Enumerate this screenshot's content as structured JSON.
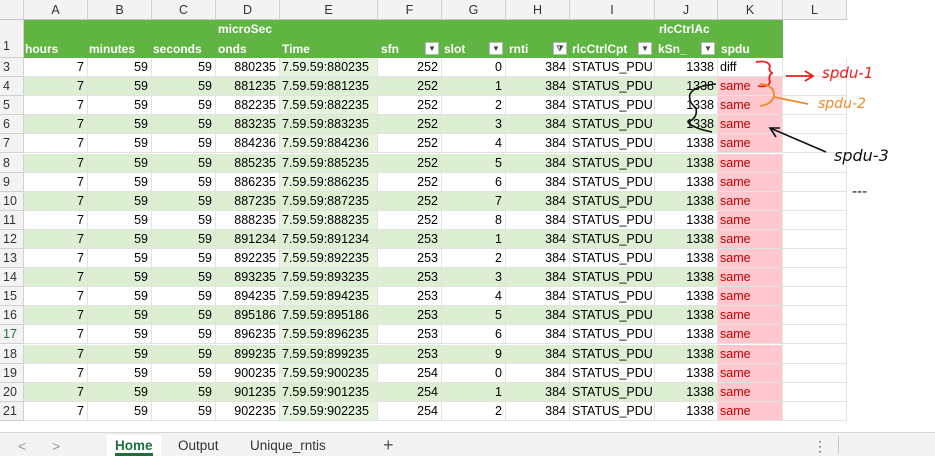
{
  "columns": [
    "A",
    "B",
    "C",
    "D",
    "E",
    "F",
    "G",
    "H",
    "I",
    "J",
    "K",
    "L"
  ],
  "header": {
    "row_number": "1",
    "hours": "hours",
    "minutes": "minutes",
    "seconds": "seconds",
    "microsec_1": "microSec",
    "microsec_2": "onds",
    "time": "Time",
    "sfn": "sfn",
    "slot": "slot",
    "rnti": "rnti",
    "rlcCtrlCpt": "rlcCtrlCpt",
    "rlcCtrlAck_1": "rlcCtrlAc",
    "rlcCtrlAck_2": "kSn_",
    "spdu": "spdu"
  },
  "rows": [
    {
      "n": "3",
      "hours": "7",
      "minutes": "59",
      "seconds": "59",
      "micro": "880235",
      "time": "7.59.59:880235",
      "sfn": "252",
      "slot": "0",
      "rnti": "384",
      "cpt": "STATUS_PDU",
      "ack": "1338",
      "spdu": "diff"
    },
    {
      "n": "4",
      "hours": "7",
      "minutes": "59",
      "seconds": "59",
      "micro": "881235",
      "time": "7.59.59:881235",
      "sfn": "252",
      "slot": "1",
      "rnti": "384",
      "cpt": "STATUS_PDU",
      "ack": "1338",
      "spdu": "same"
    },
    {
      "n": "5",
      "hours": "7",
      "minutes": "59",
      "seconds": "59",
      "micro": "882235",
      "time": "7.59.59:882235",
      "sfn": "252",
      "slot": "2",
      "rnti": "384",
      "cpt": "STATUS_PDU",
      "ack": "1338",
      "spdu": "same"
    },
    {
      "n": "6",
      "hours": "7",
      "minutes": "59",
      "seconds": "59",
      "micro": "883235",
      "time": "7.59.59:883235",
      "sfn": "252",
      "slot": "3",
      "rnti": "384",
      "cpt": "STATUS_PDU",
      "ack": "1338",
      "spdu": "same"
    },
    {
      "n": "7",
      "hours": "7",
      "minutes": "59",
      "seconds": "59",
      "micro": "884236",
      "time": "7.59.59:884236",
      "sfn": "252",
      "slot": "4",
      "rnti": "384",
      "cpt": "STATUS_PDU",
      "ack": "1338",
      "spdu": "same"
    },
    {
      "n": "8",
      "hours": "7",
      "minutes": "59",
      "seconds": "59",
      "micro": "885235",
      "time": "7.59.59:885235",
      "sfn": "252",
      "slot": "5",
      "rnti": "384",
      "cpt": "STATUS_PDU",
      "ack": "1338",
      "spdu": "same"
    },
    {
      "n": "9",
      "hours": "7",
      "minutes": "59",
      "seconds": "59",
      "micro": "886235",
      "time": "7.59.59:886235",
      "sfn": "252",
      "slot": "6",
      "rnti": "384",
      "cpt": "STATUS_PDU",
      "ack": "1338",
      "spdu": "same"
    },
    {
      "n": "10",
      "hours": "7",
      "minutes": "59",
      "seconds": "59",
      "micro": "887235",
      "time": "7.59.59:887235",
      "sfn": "252",
      "slot": "7",
      "rnti": "384",
      "cpt": "STATUS_PDU",
      "ack": "1338",
      "spdu": "same"
    },
    {
      "n": "11",
      "hours": "7",
      "minutes": "59",
      "seconds": "59",
      "micro": "888235",
      "time": "7.59.59:888235",
      "sfn": "252",
      "slot": "8",
      "rnti": "384",
      "cpt": "STATUS_PDU",
      "ack": "1338",
      "spdu": "same"
    },
    {
      "n": "12",
      "hours": "7",
      "minutes": "59",
      "seconds": "59",
      "micro": "891234",
      "time": "7.59.59:891234",
      "sfn": "253",
      "slot": "1",
      "rnti": "384",
      "cpt": "STATUS_PDU",
      "ack": "1338",
      "spdu": "same"
    },
    {
      "n": "13",
      "hours": "7",
      "minutes": "59",
      "seconds": "59",
      "micro": "892235",
      "time": "7.59.59:892235",
      "sfn": "253",
      "slot": "2",
      "rnti": "384",
      "cpt": "STATUS_PDU",
      "ack": "1338",
      "spdu": "same"
    },
    {
      "n": "14",
      "hours": "7",
      "minutes": "59",
      "seconds": "59",
      "micro": "893235",
      "time": "7.59.59:893235",
      "sfn": "253",
      "slot": "3",
      "rnti": "384",
      "cpt": "STATUS_PDU",
      "ack": "1338",
      "spdu": "same"
    },
    {
      "n": "15",
      "hours": "7",
      "minutes": "59",
      "seconds": "59",
      "micro": "894235",
      "time": "7.59.59:894235",
      "sfn": "253",
      "slot": "4",
      "rnti": "384",
      "cpt": "STATUS_PDU",
      "ack": "1338",
      "spdu": "same"
    },
    {
      "n": "16",
      "hours": "7",
      "minutes": "59",
      "seconds": "59",
      "micro": "895186",
      "time": "7.59.59:895186",
      "sfn": "253",
      "slot": "5",
      "rnti": "384",
      "cpt": "STATUS_PDU",
      "ack": "1338",
      "spdu": "same"
    },
    {
      "n": "17",
      "hours": "7",
      "minutes": "59",
      "seconds": "59",
      "micro": "896235",
      "time": "7.59.59:896235",
      "sfn": "253",
      "slot": "6",
      "rnti": "384",
      "cpt": "STATUS_PDU",
      "ack": "1338",
      "spdu": "same"
    },
    {
      "n": "18",
      "hours": "7",
      "minutes": "59",
      "seconds": "59",
      "micro": "899235",
      "time": "7.59.59:899235",
      "sfn": "253",
      "slot": "9",
      "rnti": "384",
      "cpt": "STATUS_PDU",
      "ack": "1338",
      "spdu": "same"
    },
    {
      "n": "19",
      "hours": "7",
      "minutes": "59",
      "seconds": "59",
      "micro": "900235",
      "time": "7.59.59:900235",
      "sfn": "254",
      "slot": "0",
      "rnti": "384",
      "cpt": "STATUS_PDU",
      "ack": "1338",
      "spdu": "same"
    },
    {
      "n": "20",
      "hours": "7",
      "minutes": "59",
      "seconds": "59",
      "micro": "901235",
      "time": "7.59.59:901235",
      "sfn": "254",
      "slot": "1",
      "rnti": "384",
      "cpt": "STATUS_PDU",
      "ack": "1338",
      "spdu": "same"
    },
    {
      "n": "21",
      "hours": "7",
      "minutes": "59",
      "seconds": "59",
      "micro": "902235",
      "time": "7.59.59:902235",
      "sfn": "254",
      "slot": "2",
      "rnti": "384",
      "cpt": "STATUS_PDU",
      "ack": "1338",
      "spdu": "same"
    }
  ],
  "tabs": {
    "home": "Home",
    "output": "Output",
    "unique": "Unique_rntis",
    "add": "+",
    "prev": "<",
    "next": ">",
    "more": "⋮"
  },
  "annotations": {
    "a1": "spdu-1",
    "a2": "spdu-2",
    "a3": "spdu-3",
    "a4": "---"
  },
  "colors": {
    "header_green": "#5fb442",
    "band_green": "#dcefd3",
    "time_col_green": "#e6f4de",
    "spdu_pink": "#ffc7ce",
    "spdu_text_red": "#c00000",
    "annot_red": "#e8201a",
    "annot_orange": "#f08a24"
  },
  "icons": [
    "filter-dropdown-icon",
    "filter-active-icon",
    "sheet-prev-icon",
    "sheet-next-icon",
    "add-sheet-icon",
    "more-options-icon"
  ]
}
